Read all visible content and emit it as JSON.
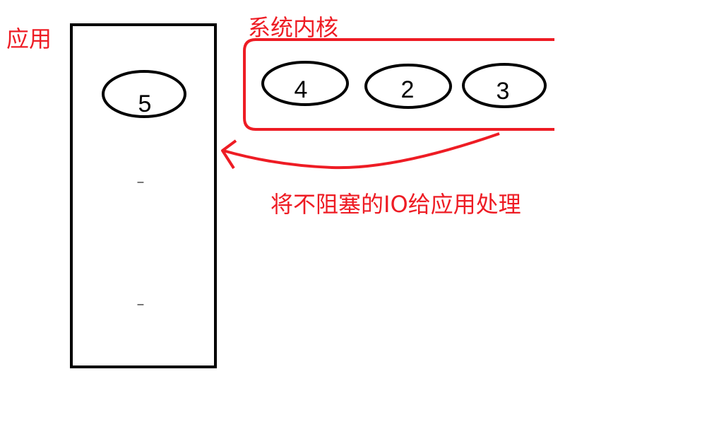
{
  "labels": {
    "application": "应用",
    "kernel": "系统内核",
    "caption": "将不阻塞的IO给应用处理"
  },
  "application_items": [
    "5"
  ],
  "application_marks": [
    "–",
    "–"
  ],
  "kernel_items": [
    "4",
    "2",
    "3"
  ],
  "colors": {
    "accent": "#ee1c24",
    "stroke": "#000000"
  }
}
